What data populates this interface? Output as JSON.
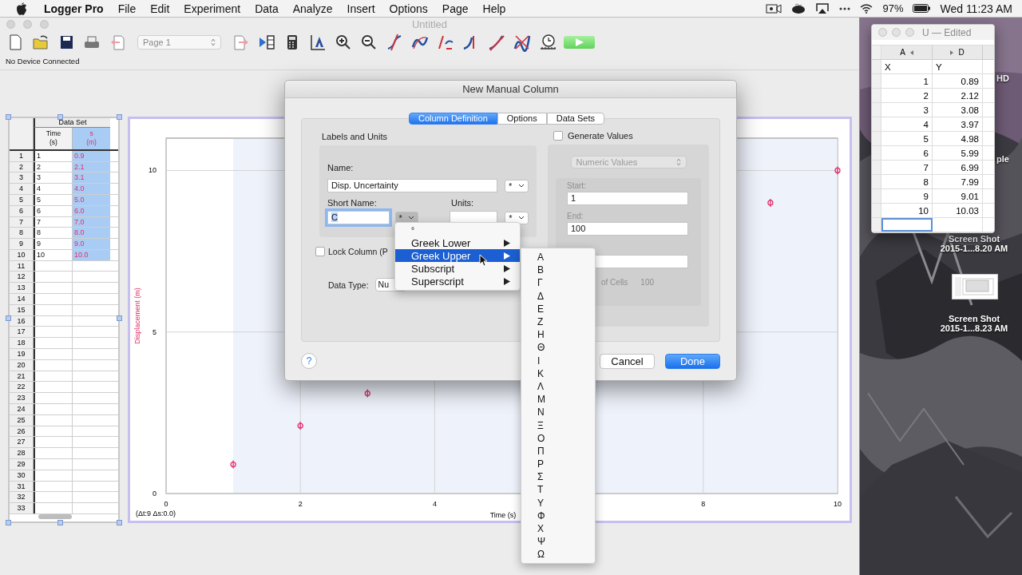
{
  "menubar": {
    "app": "Logger Pro",
    "menus": [
      "File",
      "Edit",
      "Experiment",
      "Data",
      "Analyze",
      "Insert",
      "Options",
      "Page",
      "Help"
    ],
    "battery": "97%",
    "clock": "Wed 11:23 AM"
  },
  "window": {
    "title": "Untitled",
    "page_select": "Page 1",
    "status": "No Device Connected"
  },
  "table": {
    "group": "Data Set",
    "columns": [
      {
        "name": "Time",
        "unit": "(s)",
        "selected": false,
        "kind": "x"
      },
      {
        "name": "s",
        "unit": "(m)",
        "selected": true,
        "kind": "y"
      }
    ],
    "rows": [
      {
        "n": "1",
        "cells": [
          "1",
          "0.9"
        ]
      },
      {
        "n": "2",
        "cells": [
          "2",
          "2.1"
        ]
      },
      {
        "n": "3",
        "cells": [
          "3",
          "3.1"
        ]
      },
      {
        "n": "4",
        "cells": [
          "4",
          "4.0"
        ]
      },
      {
        "n": "5",
        "cells": [
          "5",
          "5.0"
        ]
      },
      {
        "n": "6",
        "cells": [
          "6",
          "6.0"
        ]
      },
      {
        "n": "7",
        "cells": [
          "7",
          "7.0"
        ]
      },
      {
        "n": "8",
        "cells": [
          "8",
          "8.0"
        ]
      },
      {
        "n": "9",
        "cells": [
          "9",
          "9.0"
        ]
      },
      {
        "n": "10",
        "cells": [
          "10",
          "10.0"
        ]
      },
      {
        "n": "11"
      },
      {
        "n": "12"
      },
      {
        "n": "13"
      },
      {
        "n": "14"
      },
      {
        "n": "15"
      },
      {
        "n": "16"
      },
      {
        "n": "17"
      },
      {
        "n": "18"
      },
      {
        "n": "19"
      },
      {
        "n": "20"
      },
      {
        "n": "21"
      },
      {
        "n": "22"
      },
      {
        "n": "23"
      },
      {
        "n": "24"
      },
      {
        "n": "25"
      },
      {
        "n": "26"
      },
      {
        "n": "27"
      },
      {
        "n": "28"
      },
      {
        "n": "29"
      },
      {
        "n": "30"
      },
      {
        "n": "31"
      },
      {
        "n": "32"
      },
      {
        "n": "33"
      }
    ]
  },
  "graph": {
    "info": "(Δt:9 Δs:0.0)",
    "chart_data": {
      "type": "scatter",
      "xlabel": "Time (s)",
      "ylabel": "Displacement (m)",
      "x": [
        1,
        2,
        3,
        9,
        10
      ],
      "series": [
        {
          "color": "#e0306a",
          "values": [
            0.9,
            2.1,
            3.1,
            9.0,
            10.0
          ]
        }
      ],
      "xlim": [
        0,
        10
      ],
      "ylim": [
        0,
        11
      ],
      "xticks": [
        0,
        2,
        4,
        8,
        10
      ],
      "yticks": [
        0,
        5,
        10
      ],
      "grid": true,
      "bands": [
        {
          "axis": "x",
          "from": 1,
          "to": 10
        }
      ]
    }
  },
  "dialog": {
    "title": "New Manual Column",
    "tabs": [
      {
        "label": "Column Definition",
        "selected": true
      },
      {
        "label": "Options",
        "selected": false
      },
      {
        "label": "Data Sets",
        "selected": false
      }
    ],
    "labels": {
      "title": "Labels and Units",
      "name_label": "Name:",
      "name_value": "Disp. Uncertainty",
      "name_symbol": "*",
      "short_name_label": "Short Name:",
      "short_name_value": "C",
      "short_symbol": "*",
      "units_label": "Units:",
      "units_symbol": "*"
    },
    "lock_column": {
      "label": "Lock Column (P",
      "checked": false
    },
    "data_type": {
      "label": "Data Type:",
      "value": "Nu"
    },
    "generate": {
      "label": "Generate Values",
      "checked": false,
      "mode": "Numeric Values",
      "start_label": "Start:",
      "start": "1",
      "end_label": "End:",
      "end": "100",
      "cells_label": "of Cells",
      "cells": "100"
    },
    "help": "?",
    "buttons": [
      {
        "label": "Cancel",
        "default": false
      },
      {
        "label": "Done",
        "default": true
      }
    ]
  },
  "symbol_menu": {
    "items": [
      {
        "label": "°",
        "submenu": false,
        "selected": false
      },
      {
        "label": "Greek Lower",
        "submenu": true,
        "selected": false
      },
      {
        "label": "Greek Upper",
        "submenu": true,
        "selected": true
      },
      {
        "label": "Subscript",
        "submenu": true,
        "selected": false
      },
      {
        "label": "Superscript",
        "submenu": true,
        "selected": false
      }
    ]
  },
  "greek_menu": {
    "items": [
      "Α",
      "Β",
      "Γ",
      "Δ",
      "Ε",
      "Ζ",
      "Η",
      "Θ",
      "Ι",
      "Κ",
      "Λ",
      "Μ",
      "Ν",
      "Ξ",
      "Ο",
      "Π",
      "Ρ",
      "Σ",
      "Τ",
      "Υ",
      "Φ",
      "Χ",
      "Ψ",
      "Ω"
    ]
  },
  "spreadsheet": {
    "title": "U — Edited",
    "columns": [
      "A",
      "D"
    ],
    "rows": [
      {
        "kind": "text",
        "cells": [
          "X",
          "Y"
        ]
      },
      {
        "kind": "number",
        "cells": [
          "1",
          "0.89"
        ]
      },
      {
        "kind": "number",
        "cells": [
          "2",
          "2.12"
        ]
      },
      {
        "kind": "number",
        "cells": [
          "3",
          "3.08"
        ]
      },
      {
        "kind": "number",
        "cells": [
          "4",
          "3.97"
        ]
      },
      {
        "kind": "number",
        "cells": [
          "5",
          "4.98"
        ]
      },
      {
        "kind": "number",
        "cells": [
          "6",
          "5.99"
        ]
      },
      {
        "kind": "number",
        "cells": [
          "7",
          "6.99"
        ]
      },
      {
        "kind": "number",
        "cells": [
          "8",
          "7.99"
        ]
      },
      {
        "kind": "number",
        "cells": [
          "9",
          "9.01"
        ]
      },
      {
        "kind": "number",
        "cells": [
          "10",
          "10.03"
        ]
      },
      {
        "kind": "empty",
        "selected": true
      }
    ]
  },
  "desktop": {
    "partial_labels": [
      "HD",
      "ple"
    ],
    "files": [
      {
        "line1": "Screen Shot",
        "line2": "2015-1...8.20 AM"
      },
      {
        "line1": "Screen Shot",
        "line2": "2015-1...8.23 AM",
        "thumbnail": true
      }
    ]
  }
}
